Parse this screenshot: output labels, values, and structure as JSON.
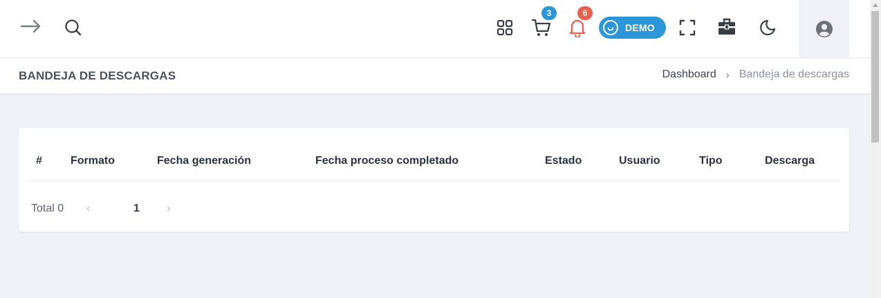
{
  "header": {
    "back_icon": "arrow-right-icon",
    "search_icon": "search-icon",
    "apps_icon": "grid-icon",
    "cart_icon": "cart-icon",
    "cart_badge": "3",
    "notifications_icon": "bell-icon",
    "notifications_badge": "6",
    "demo_label": "DEMO",
    "fullscreen_icon": "fullscreen-icon",
    "briefcase_icon": "briefcase-icon",
    "theme_icon": "moon-icon",
    "user_icon": "user-circle-icon"
  },
  "page": {
    "title": "BANDEJA DE DESCARGAS",
    "breadcrumb": {
      "home": "Dashboard",
      "separator": "›",
      "current": "Bandeja de descargas"
    }
  },
  "table": {
    "columns": [
      "#",
      "Formato",
      "Fecha generación",
      "Fecha proceso completado",
      "Estado",
      "Usuario",
      "Tipo",
      "Descarga"
    ],
    "rows": []
  },
  "pagination": {
    "total_label": "Total 0",
    "prev": "‹",
    "current_page": "1",
    "next": "›"
  },
  "colors": {
    "accent_blue": "#2d96d8",
    "badge_red": "#ec5f4c",
    "bell_color": "#ec5f4c",
    "background": "#f1f2f7"
  }
}
